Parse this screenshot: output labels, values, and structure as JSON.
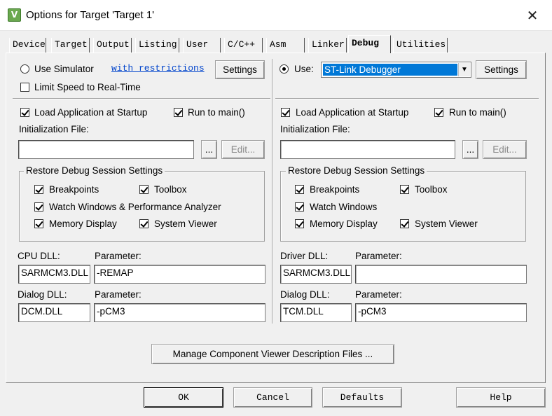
{
  "window": {
    "title": "Options for Target 'Target 1'",
    "close_glyph": "✕",
    "icon_glyph": "V"
  },
  "tabs": [
    {
      "label": "Device"
    },
    {
      "label": "Target"
    },
    {
      "label": "Output"
    },
    {
      "label": "Listing"
    },
    {
      "label": "User"
    },
    {
      "label": "C/C++"
    },
    {
      "label": "Asm"
    },
    {
      "label": "Linker"
    },
    {
      "label": "Debug",
      "active": true
    },
    {
      "label": "Utilities"
    }
  ],
  "left": {
    "use_simulator_label": "Use Simulator",
    "restrictions_link": "with restrictions",
    "settings_label": "Settings",
    "limit_speed_label": "Limit Speed to Real-Time",
    "load_app_label": "Load Application at Startup",
    "run_to_main_label": "Run to main()",
    "init_file_label": "Initialization File:",
    "init_file_value": "",
    "browse_label": "...",
    "edit_label": "Edit...",
    "restore_title": "Restore Debug Session Settings",
    "breakpoints_label": "Breakpoints",
    "toolbox_label": "Toolbox",
    "watch_label": "Watch Windows & Performance Analyzer",
    "memory_label": "Memory Display",
    "sysviewer_label": "System Viewer",
    "cpu_dll_label": "CPU DLL:",
    "cpu_param_label": "Parameter:",
    "cpu_dll_value": "SARMCM3.DLL",
    "cpu_param_value": "-REMAP",
    "dialog_dll_label": "Dialog DLL:",
    "dialog_param_label": "Parameter:",
    "dialog_dll_value": "DCM.DLL",
    "dialog_param_value": "-pCM3"
  },
  "right": {
    "use_label": "Use:",
    "debugger_value": "ST-Link Debugger",
    "settings_label": "Settings",
    "load_app_label": "Load Application at Startup",
    "run_to_main_label": "Run to main()",
    "init_file_label": "Initialization File:",
    "init_file_value": "",
    "browse_label": "...",
    "edit_label": "Edit...",
    "restore_title": "Restore Debug Session Settings",
    "breakpoints_label": "Breakpoints",
    "toolbox_label": "Toolbox",
    "watch_label": "Watch Windows",
    "memory_label": "Memory Display",
    "sysviewer_label": "System Viewer",
    "driver_dll_label": "Driver DLL:",
    "driver_param_label": "Parameter:",
    "driver_dll_value": "SARMCM3.DLL",
    "driver_param_value": "",
    "dialog_dll_label": "Dialog DLL:",
    "dialog_param_label": "Parameter:",
    "dialog_dll_value": "TCM.DLL",
    "dialog_param_value": "-pCM3"
  },
  "manage_viewer_label": "Manage Component Viewer Description Files ...",
  "footer": {
    "ok": "OK",
    "cancel": "Cancel",
    "defaults": "Defaults",
    "help": "Help"
  }
}
